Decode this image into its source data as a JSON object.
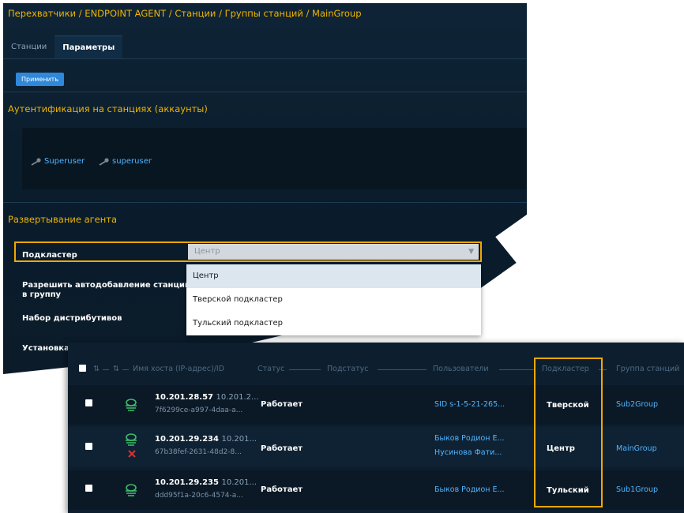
{
  "breadcrumb": "Перехватчики / ENDPOINT AGENT / Станции / Группы станций / MainGroup",
  "tabs": [
    {
      "label": "Станции",
      "active": false
    },
    {
      "label": "Параметры",
      "active": true
    }
  ],
  "apply_button": "Применить",
  "auth": {
    "title": "Аутентификация на станциях (аккаунты)",
    "accounts": [
      "Superuser",
      "superuser"
    ]
  },
  "deploy": {
    "title": "Развертывание агента",
    "subcluster_label": "Подкластер",
    "subcluster_value": "Центр",
    "autoadd_label": "Разрешить автодобавление станций в группу",
    "distrib_label": "Набор дистрибутивов",
    "install_label": "Установка",
    "options": [
      "Центр",
      "Тверской подкластер",
      "Тульский подкластер"
    ]
  },
  "table": {
    "headers": {
      "hostname": "Имя хоста (IP-адрес)/ID",
      "status": "Статус",
      "substatus": "Подстатус",
      "users": "Пользователи",
      "subcluster": "Подкластер",
      "group": "Группа станций"
    },
    "sort_marks": [
      "⇅",
      "⇅"
    ],
    "rows": [
      {
        "host": "10.201.28.57",
        "ip": "10.201.2...",
        "id": "7f6299ce-a997-4daa-a...",
        "status": "Работает",
        "users": [
          "SID s-1-5-21-265..."
        ],
        "subcluster": "Тверской",
        "group": "Sub2Group",
        "error": false
      },
      {
        "host": "10.201.29.234",
        "ip": "10.201...",
        "id": "67b38fef-2631-48d2-8...",
        "status": "Работает",
        "users": [
          "Быков Родион Е...",
          "Нусинова Фати..."
        ],
        "subcluster": "Центр",
        "group": "MainGroup",
        "error": true
      },
      {
        "host": "10.201.29.235",
        "ip": "10.201...",
        "id": "ddd95f1a-20c6-4574-a...",
        "status": "Работает",
        "users": [
          "Быков Родион Е..."
        ],
        "subcluster": "Тульский",
        "group": "Sub1Group",
        "error": false
      }
    ]
  },
  "colors": {
    "accent": "#f0b400",
    "link": "#4fb4ff",
    "agent_icon": "#3dbf6a",
    "error": "#e03030"
  }
}
